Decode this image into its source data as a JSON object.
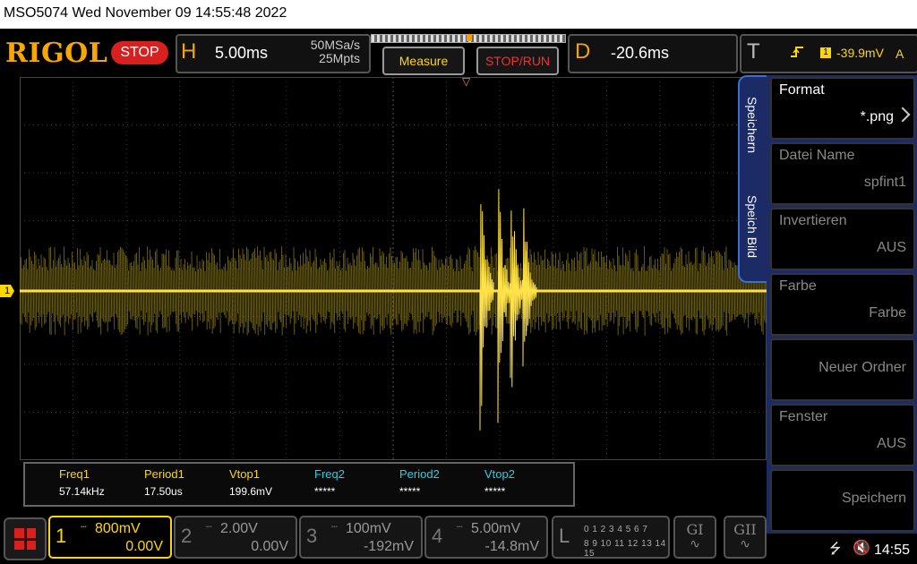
{
  "title_bar": {
    "text": "MSO5074  Wed November 09 14:55:48 2022"
  },
  "header": {
    "logo": "RIGOL",
    "run_state": "STOP",
    "horizontal": {
      "letter": "H",
      "timebase": "5.00ms",
      "sample_rate": "50MSa/s",
      "memory_depth": "25Mpts"
    },
    "measure_label": "Measure",
    "stop_run_label": "STOP/RUN",
    "delay": {
      "letter": "D",
      "value": "-20.6ms"
    },
    "trigger": {
      "letter": "T",
      "edge_icon": "rising-edge-icon",
      "source": "1",
      "level": "-39.9mV",
      "unit_tag": "A"
    }
  },
  "waveform": {
    "channel_marker": "1",
    "trigger_marker_icon": "trigger-position-icon",
    "trace_color": "#ffd700"
  },
  "measurements": [
    {
      "label": "Freq1",
      "value": "57.14kHz",
      "color": "#ffd700"
    },
    {
      "label": "Period1",
      "value": "17.50us",
      "color": "#ffd700"
    },
    {
      "label": "Vtop1",
      "value": "199.6mV",
      "color": "#ffd700"
    },
    {
      "label": "Freq2",
      "value": "*****",
      "color": "#22d3e6"
    },
    {
      "label": "Period2",
      "value": "*****",
      "color": "#22d3e6"
    },
    {
      "label": "Vtop2",
      "value": "*****",
      "color": "#22d3e6"
    }
  ],
  "side_tabs": {
    "tab1": "Speichern",
    "tab2": "Speich Bild"
  },
  "side_menu": [
    {
      "label": "Format",
      "value": "*.png",
      "has_arrow": true,
      "dim": false
    },
    {
      "label": "Datei Name",
      "value": "spfint1",
      "has_arrow": false,
      "dim": true
    },
    {
      "label": "Invertieren",
      "value": "AUS",
      "has_arrow": false,
      "dim": true
    },
    {
      "label": "Farbe",
      "value": "Farbe",
      "has_arrow": false,
      "dim": true
    },
    {
      "label": "",
      "value": "Neuer Ordner",
      "has_arrow": false,
      "dim": true
    },
    {
      "label": "Fenster",
      "value": "AUS",
      "has_arrow": false,
      "dim": true
    },
    {
      "label": "",
      "value": "Speichern",
      "has_arrow": false,
      "dim": true
    }
  ],
  "channels": [
    {
      "num": "1",
      "scale": "800mV",
      "offset": "0.00V",
      "coupling_icon": "dc-coupling-icon",
      "active": true
    },
    {
      "num": "2",
      "scale": "2.00V",
      "offset": "0.00V",
      "coupling_icon": "dc-coupling-icon",
      "active": false
    },
    {
      "num": "3",
      "scale": "100mV",
      "offset": "-192mV",
      "coupling_icon": "dc-coupling-icon",
      "active": false
    },
    {
      "num": "4",
      "scale": "5.00mV",
      "offset": "-14.8mV",
      "coupling_icon": "dc-coupling-icon",
      "active": false
    }
  ],
  "logic": {
    "letter": "L",
    "row1": "0 1 2 3   4 5 6 7",
    "row2": "8 9 10 11 12 13 14 15"
  },
  "generators": [
    {
      "label": "GI"
    },
    {
      "label": "GII"
    }
  ],
  "status": {
    "usb_icon": "usb-icon",
    "speaker_icon": "speaker-muted-icon",
    "time": "14:55"
  }
}
